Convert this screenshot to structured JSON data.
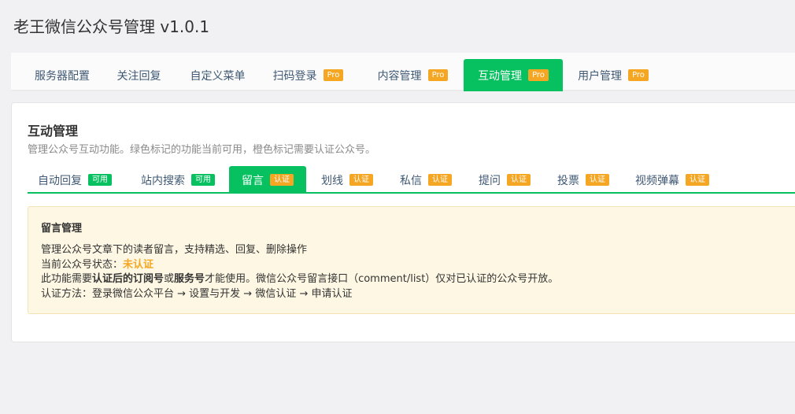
{
  "app": {
    "title": "老王微信公众号管理 v1.0.1"
  },
  "top_tabs": [
    {
      "label": "服务器配置",
      "badge": ""
    },
    {
      "label": "关注回复",
      "badge": ""
    },
    {
      "label": "自定义菜单",
      "badge": ""
    },
    {
      "label": "扫码登录",
      "badge": "Pro"
    },
    {
      "label": "内容管理",
      "badge": "Pro"
    },
    {
      "label": "互动管理",
      "badge": "Pro",
      "active": true
    },
    {
      "label": "用户管理",
      "badge": "Pro"
    }
  ],
  "card": {
    "title": "互动管理",
    "description": "管理公众号互动功能。绿色标记的功能当前可用，橙色标记需要认证公众号。"
  },
  "sub_tabs": [
    {
      "label": "自动回复",
      "badge": "可用",
      "badge_color": "#07c160"
    },
    {
      "label": "站内搜索",
      "badge": "可用",
      "badge_color": "#07c160"
    },
    {
      "label": "留言",
      "badge": "认证",
      "badge_color": "#f5a623",
      "active": true
    },
    {
      "label": "划线",
      "badge": "认证",
      "badge_color": "#f5a623"
    },
    {
      "label": "私信",
      "badge": "认证",
      "badge_color": "#f5a623"
    },
    {
      "label": "提问",
      "badge": "认证",
      "badge_color": "#f5a623"
    },
    {
      "label": "投票",
      "badge": "认证",
      "badge_color": "#f5a623"
    },
    {
      "label": "视频弹幕",
      "badge": "认证",
      "badge_color": "#f5a623"
    }
  ],
  "notice": {
    "title": "留言管理",
    "line1": "管理公众号文章下的读者留言，支持精选、回复、删除操作",
    "status_label": "当前公众号状态：",
    "status_value": "未认证",
    "line3_pre": "此功能需要",
    "line3_bold1": "认证后的订阅号",
    "line3_mid": "或",
    "line3_bold2": "服务号",
    "line3_post": "才能使用。微信公众号留言接口（comment/list）仅对已认证的公众号开放。",
    "line4": "认证方法：登录微信公众平台 → 设置与开发 → 微信认证 → 申请认证"
  },
  "colors": {
    "accent": "#07c160",
    "warning": "#f5a623",
    "notice_bg": "#fdf7e3"
  }
}
